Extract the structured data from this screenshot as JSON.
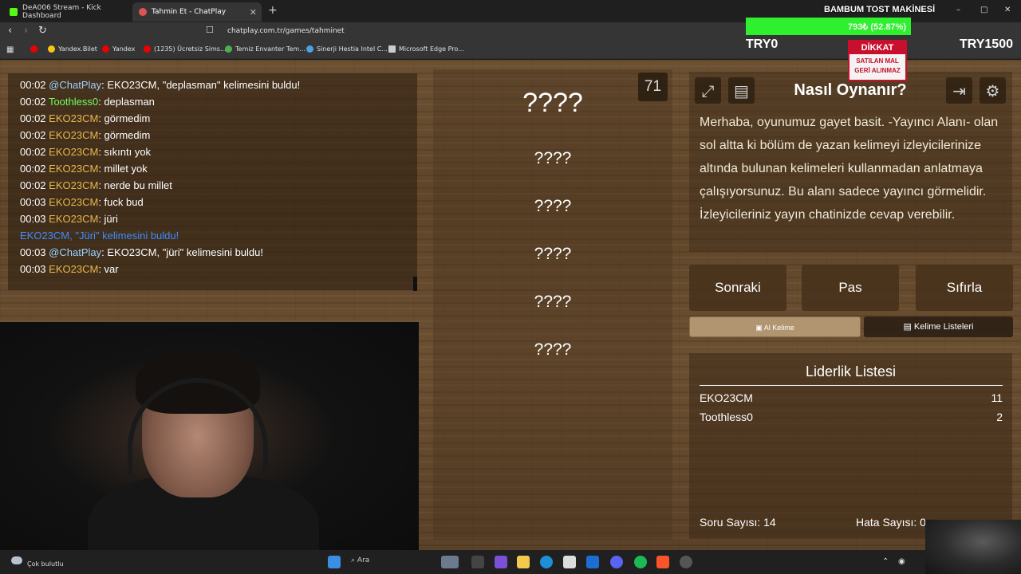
{
  "browser": {
    "tabs": [
      {
        "label": "DeA006 Stream - Kick Dashboard",
        "active": false,
        "favicon_color": "#53fc18"
      },
      {
        "label": "Tahmin Et - ChatPlay",
        "active": true,
        "favicon_color": "#e05353"
      }
    ],
    "url": "chatplay.com.tr/games/tahminet",
    "bookmarks": [
      {
        "label": "Yandex.Bilet",
        "icon": "yandex-bilet-icon",
        "color": "#f5c518"
      },
      {
        "label": "Yandex",
        "icon": "yandex-icon",
        "color": "#e00"
      },
      {
        "label": "(1235) Ücretsiz Sims...",
        "icon": "youtube-icon",
        "color": "#e00"
      },
      {
        "label": "Temiz Envanter Tem...",
        "icon": "puzzle-icon",
        "color": "#4caf50"
      },
      {
        "label": "Sinerji Hestia Intel C...",
        "icon": "diamond-icon",
        "color": "#4aa3df"
      },
      {
        "label": "Microsoft Edge Pro...",
        "icon": "folder-icon",
        "color": "#ccc"
      }
    ]
  },
  "overlay": {
    "title": "BAMBUM TOST MAKİNESİ",
    "progress_text": "793₺ (52.87%)",
    "progress_fraction": 0.5287,
    "left_label": "TRY0",
    "right_label": "TRY1500",
    "sign_header": "DİKKAT",
    "sign_line1": "SATILAN MAL",
    "sign_line2": "GERİ ALINMAZ"
  },
  "chat": {
    "messages": [
      {
        "time": "00:02",
        "user": "@ChatPlay",
        "user_class": "u-chatplay",
        "text": ": EKO23CM, \"deplasman\" kelimesini buldu!"
      },
      {
        "time": "00:02",
        "user": "Toothless0",
        "user_class": "u-green",
        "text": ": deplasman"
      },
      {
        "time": "00:02",
        "user": "EKO23CM",
        "user_class": "u-orange",
        "text": ": görmedim"
      },
      {
        "time": "00:02",
        "user": "EKO23CM",
        "user_class": "u-orange",
        "text": ": görmedim"
      },
      {
        "time": "00:02",
        "user": "EKO23CM",
        "user_class": "u-orange",
        "text": ": sıkıntı yok"
      },
      {
        "time": "00:02",
        "user": "EKO23CM",
        "user_class": "u-orange",
        "text": ": millet yok"
      },
      {
        "time": "00:02",
        "user": "EKO23CM",
        "user_class": "u-orange",
        "text": ": nerde bu millet"
      },
      {
        "time": "00:03",
        "user": "EKO23CM",
        "user_class": "u-orange",
        "text": ": fuck bud"
      },
      {
        "time": "00:03",
        "user": "EKO23CM",
        "user_class": "u-orange",
        "text": ": jüri"
      }
    ],
    "system_message": "EKO23CM, \"Jüri\" kelimesini buldu!",
    "messages_after": [
      {
        "time": "00:03",
        "user": "@ChatPlay",
        "user_class": "u-chatplay",
        "text": ": EKO23CM, \"jüri\" kelimesini buldu!"
      },
      {
        "time": "00:03",
        "user": "EKO23CM",
        "user_class": "u-orange",
        "text": ": var"
      }
    ]
  },
  "game": {
    "counter": "71",
    "words": [
      "????",
      "????",
      "????",
      "????",
      "????",
      "????"
    ]
  },
  "howto": {
    "title": "Nasıl Oynanır?",
    "text": "Merhaba, oyunumuz gayet basit. -Yayıncı Alanı- olan sol altta ki bölüm de yazan kelimeyi izleyicilerinize altında bulunan kelimeleri kullanmadan anlatmaya çalışıyorsunuz. Bu alanı sadece yayıncı görmelidir. İzleyicileriniz yayın chatinizde cevap verebilir.",
    "icons": [
      "fullscreen-icon",
      "document-icon",
      "exit-icon",
      "gear-icon"
    ]
  },
  "actions": {
    "next": "Sonraki",
    "pass": "Pas",
    "reset": "Sıfırla",
    "tab_get_word": "Al Kelime",
    "tab_word_lists": "Kelime Listeleri"
  },
  "leaderboard": {
    "title": "Liderlik Listesi",
    "rows": [
      {
        "name": "EKO23CM",
        "score": "11"
      },
      {
        "name": "Toothless0",
        "score": "2"
      }
    ],
    "question_count_label": "Soru Sayısı: 14",
    "error_count_label": "Hata Sayısı: 0"
  },
  "taskbar": {
    "weather": "Çok bulutlu",
    "search": "Ara"
  }
}
